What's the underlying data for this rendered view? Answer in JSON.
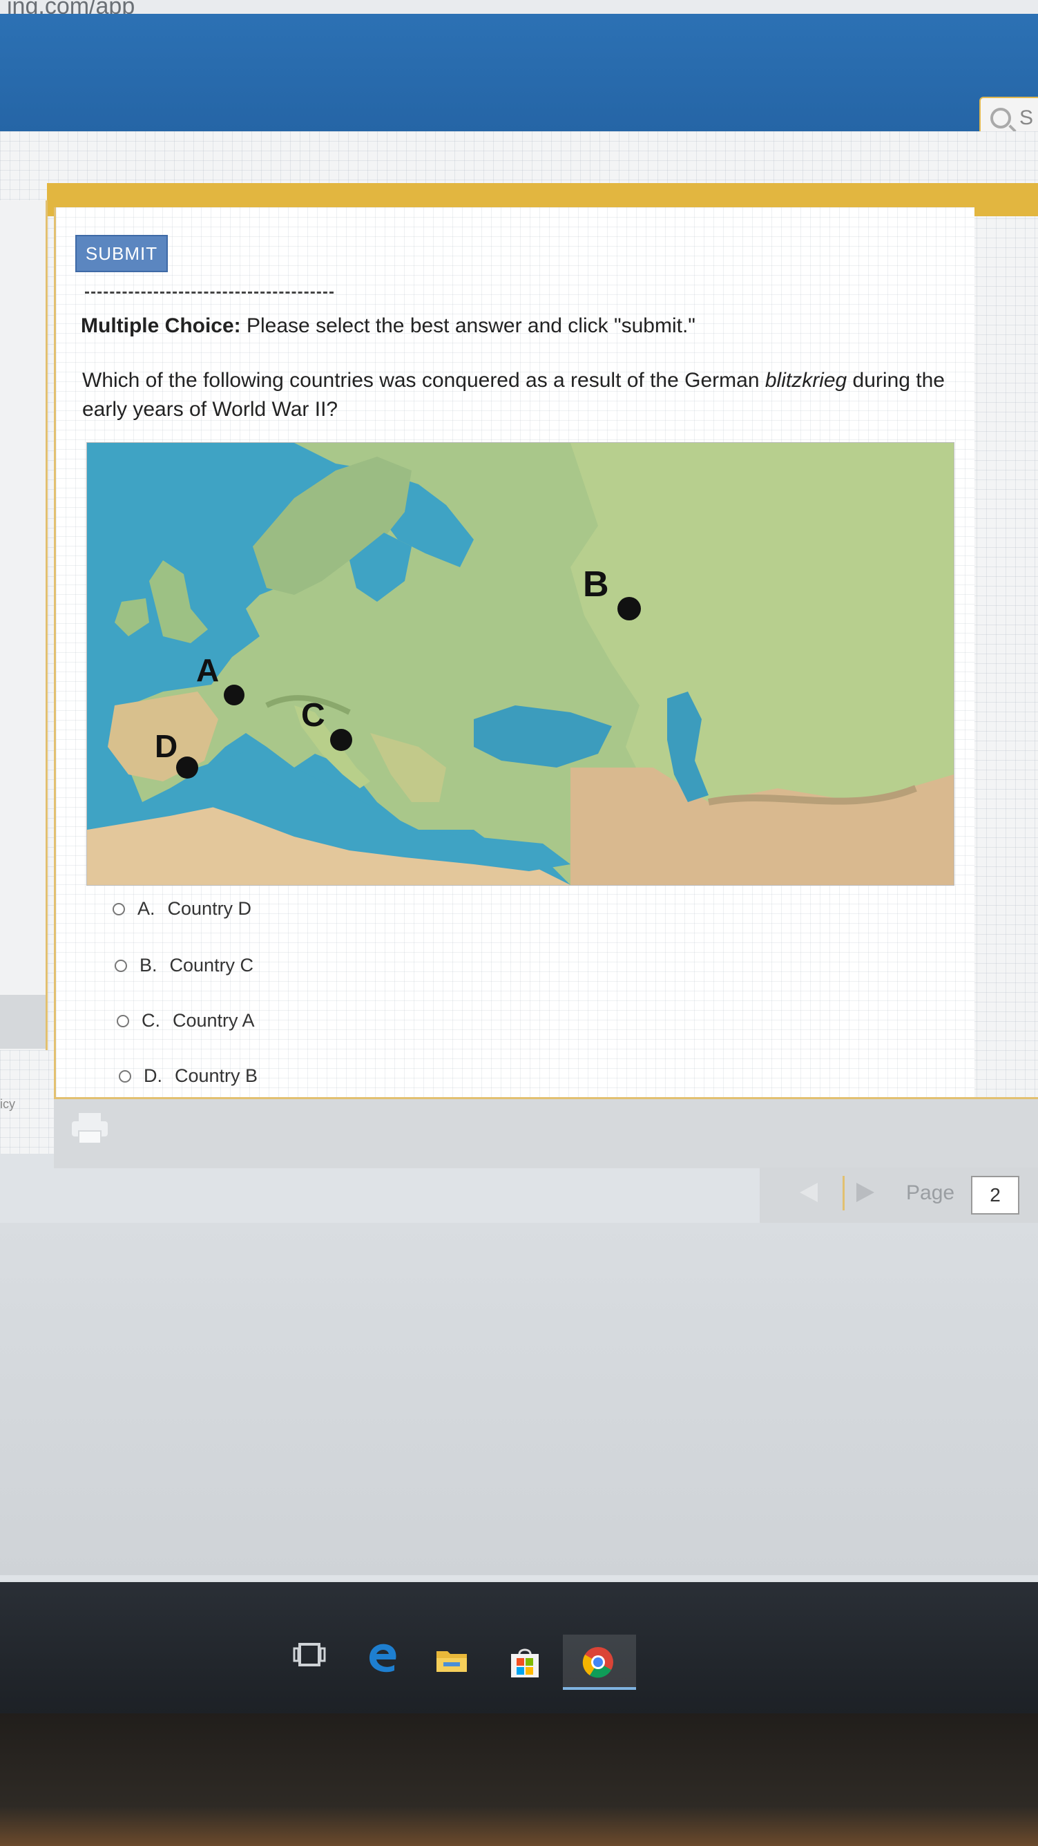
{
  "browser": {
    "url_fragment": "ing.com/app"
  },
  "header": {
    "search_placeholder": "S"
  },
  "toolbar": {
    "submit_label": "SUBMIT"
  },
  "instructions": {
    "bold": "Multiple Choice:",
    "text": " Please select the best answer and click \"submit.\""
  },
  "question": {
    "before": "Which of the following countries was conquered as a result of the German ",
    "italic": "blitzkrieg",
    "after": " during the early years of World War II?"
  },
  "map": {
    "markers": [
      "A",
      "B",
      "C",
      "D"
    ]
  },
  "answers": [
    {
      "letter": "A.",
      "text": "Country D"
    },
    {
      "letter": "B.",
      "text": "Country C"
    },
    {
      "letter": "C.",
      "text": "Country A"
    },
    {
      "letter": "D.",
      "text": "Country B"
    }
  ],
  "sidebar": {
    "link_fragment": "icy"
  },
  "pagination": {
    "label": "Page",
    "value": "2"
  },
  "taskbar": {
    "icons": [
      "task-view-icon",
      "edge-icon",
      "file-explorer-icon",
      "store-icon",
      "chrome-icon"
    ]
  }
}
